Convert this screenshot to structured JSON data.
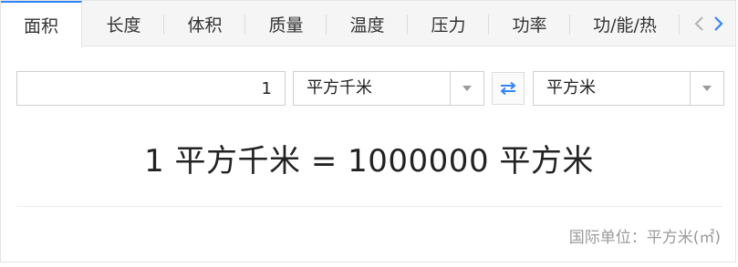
{
  "tabs": [
    {
      "label": "面积",
      "active": true
    },
    {
      "label": "长度",
      "active": false
    },
    {
      "label": "体积",
      "active": false
    },
    {
      "label": "质量",
      "active": false
    },
    {
      "label": "温度",
      "active": false
    },
    {
      "label": "压力",
      "active": false
    },
    {
      "label": "功率",
      "active": false
    },
    {
      "label": "功/能/热",
      "active": false
    }
  ],
  "nav": {
    "prev_icon": "chevron-left-icon",
    "next_icon": "chevron-right-icon"
  },
  "converter": {
    "input_value": "1",
    "from_unit": "平方千米",
    "to_unit": "平方米",
    "swap_icon": "swap-arrows-icon",
    "result": "1 平方千米 = 1000000 平方米"
  },
  "footer": {
    "si_unit": "国际单位：平方米(㎡)"
  },
  "colors": {
    "accent": "#3385ff",
    "tab_bar_bg": "#f5f5f5",
    "muted_text": "#9a9a9a"
  }
}
